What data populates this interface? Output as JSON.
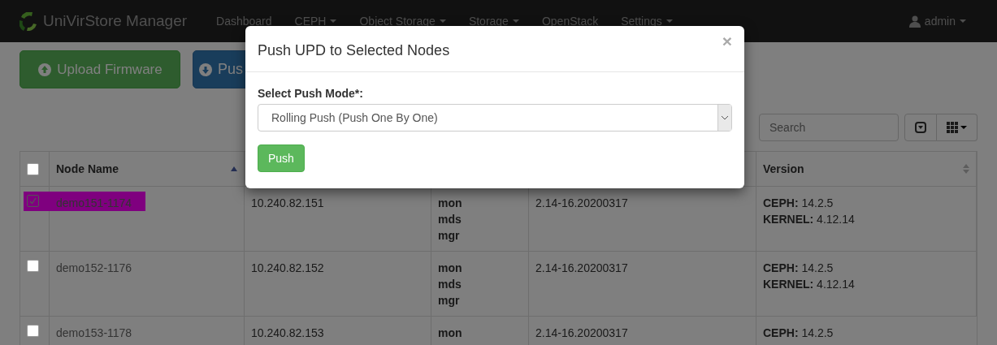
{
  "navbar": {
    "brand": "UniVirStore Manager",
    "items": [
      {
        "label": "Dashboard",
        "dropdown": false
      },
      {
        "label": "CEPH",
        "dropdown": true
      },
      {
        "label": "Object Storage",
        "dropdown": true
      },
      {
        "label": "Storage",
        "dropdown": true
      },
      {
        "label": "OpenStack",
        "dropdown": false
      },
      {
        "label": "Settings",
        "dropdown": true
      }
    ],
    "user": {
      "label": "admin",
      "dropdown": true
    }
  },
  "actions": [
    {
      "label": "Upload Firmware",
      "kind": "upload"
    },
    {
      "label": "Pus",
      "kind": "push"
    }
  ],
  "table_toolbar": {
    "search": {
      "placeholder": "Search"
    }
  },
  "table": {
    "all_selected": false,
    "columns": [
      {
        "label": "Node Name",
        "sorted": true
      },
      {
        "label": "Version",
        "sorted": false
      }
    ],
    "rows": [
      {
        "selected": true,
        "node_name": "demo151-1174",
        "ip": "10.240.82.151",
        "roles": [
          "mon",
          "mds",
          "mgr"
        ],
        "build": "2.14-16.20200317",
        "versions": [
          "**CEPH:** 14.2.5",
          "**KERNEL:** 4.12.14"
        ]
      },
      {
        "selected": false,
        "node_name": "demo152-1176",
        "ip": "10.240.82.152",
        "roles": [
          "mon",
          "mds",
          "mgr"
        ],
        "build": "2.14-16.20200317",
        "versions": [
          "**CEPH:** 14.2.5",
          "**KERNEL:** 4.12.14"
        ]
      },
      {
        "selected": false,
        "node_name": "demo153-1178",
        "ip": "10.240.82.153",
        "roles": [
          "mon"
        ],
        "build": "2.14-16.20200317",
        "versions": [
          "**CEPH:** 14.2.5"
        ]
      }
    ]
  },
  "modal": {
    "title": "Push UPD to Selected Nodes",
    "close": "×",
    "field_label": "Select Push Mode*:",
    "select_value": "Rolling Push (Push One By One)",
    "submit": "Push"
  }
}
